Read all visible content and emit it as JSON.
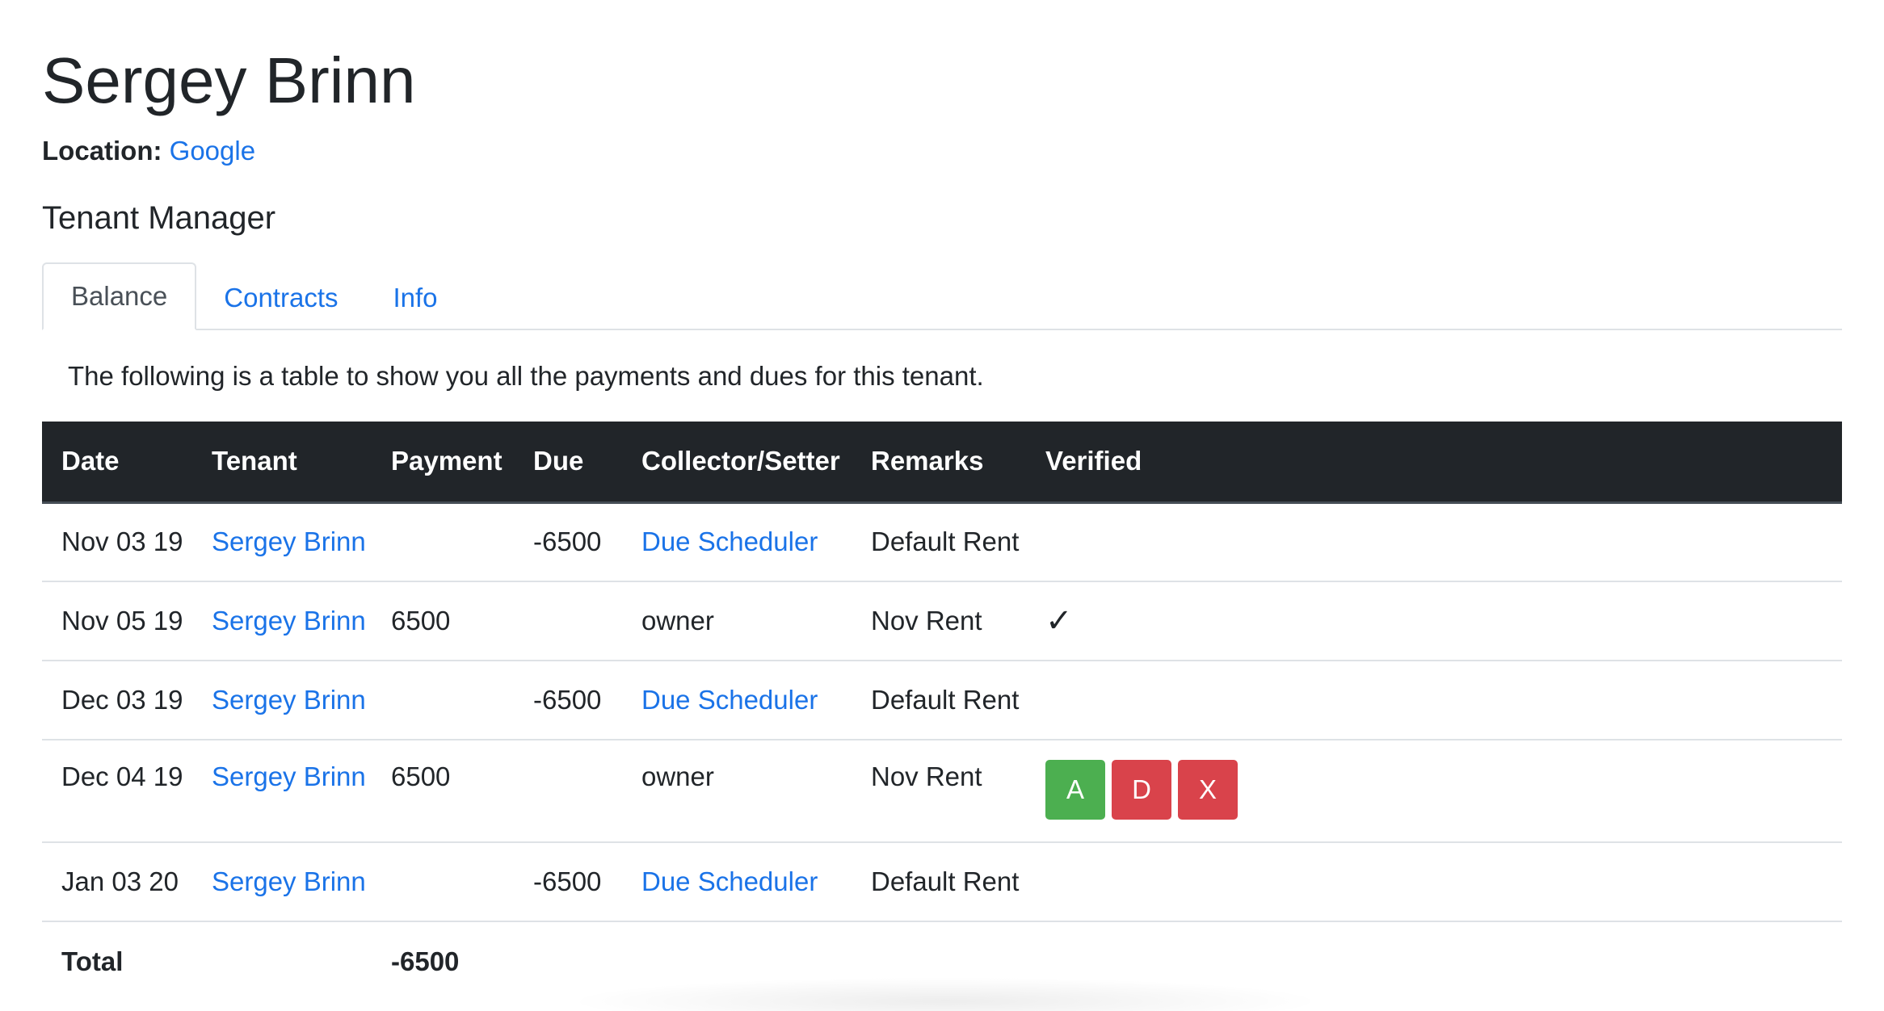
{
  "header": {
    "name": "Sergey Brinn",
    "location_label": "Location:",
    "location_value": "Google"
  },
  "section_title": "Tenant Manager",
  "tabs": [
    {
      "label": "Balance",
      "active": true
    },
    {
      "label": "Contracts",
      "active": false
    },
    {
      "label": "Info",
      "active": false
    }
  ],
  "description": "The following is a table to show you all the payments and dues for this tenant.",
  "table": {
    "headers": [
      "Date",
      "Tenant",
      "Payment",
      "Due",
      "Collector/Setter",
      "Remarks",
      "Verified"
    ],
    "rows": [
      {
        "date": "Nov 03 19",
        "tenant": "Sergey Brinn",
        "payment": "",
        "due": "-6500",
        "collector": "Due Scheduler",
        "remarks": "Default Rent",
        "verified": ""
      },
      {
        "date": "Nov 05 19",
        "tenant": "Sergey Brinn",
        "payment": "6500",
        "due": "",
        "collector": "owner",
        "remarks": "Nov Rent",
        "verified": "✓"
      },
      {
        "date": "Dec 03 19",
        "tenant": "Sergey Brinn",
        "payment": "",
        "due": "-6500",
        "collector": "Due Scheduler",
        "remarks": "Default Rent",
        "verified": ""
      },
      {
        "date": "Dec 04 19",
        "tenant": "Sergey Brinn",
        "payment": "6500",
        "due": "",
        "collector": "owner",
        "remarks": "Nov Rent",
        "verified": ""
      },
      {
        "date": "Jan 03 20",
        "tenant": "Sergey Brinn",
        "payment": "",
        "due": "-6500",
        "collector": "Due Scheduler",
        "remarks": "Default Rent",
        "verified": ""
      }
    ],
    "total_label": "Total",
    "total_value": "-6500"
  },
  "actions": {
    "approve_label": "A",
    "decline_label": "D",
    "delete_label": "X"
  },
  "colors": {
    "link": "#1a73e8",
    "header_bg": "#212529",
    "approve": "#4caf50",
    "decline": "#d9434b"
  }
}
